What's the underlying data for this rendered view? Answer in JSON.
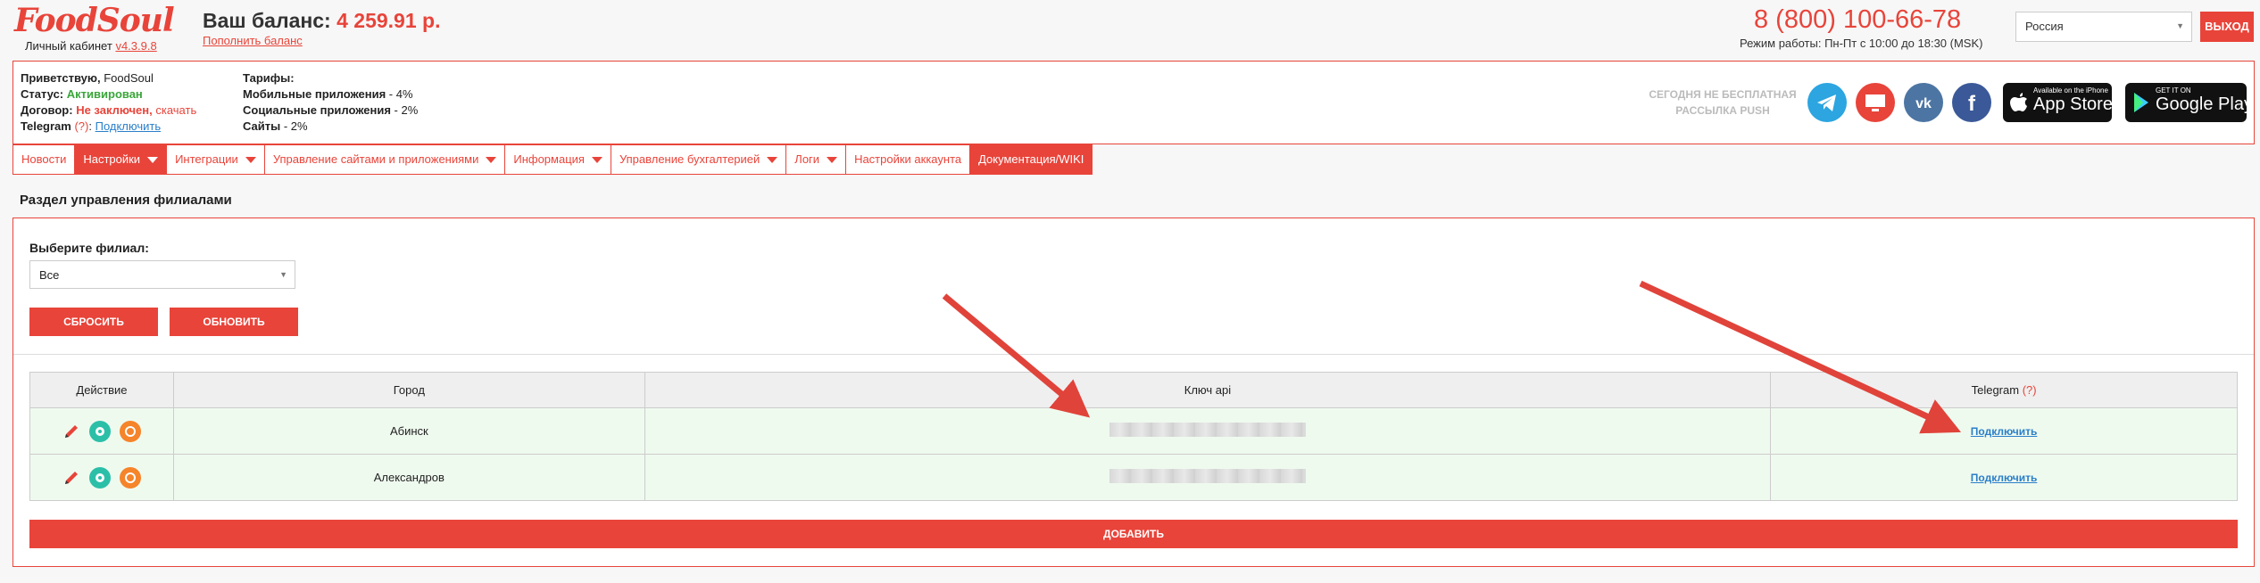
{
  "header": {
    "logo": "FoodSoul",
    "cabinet_label": "Личный кабинет",
    "version": "v4.3.9.8",
    "balance_label": "Ваш баланс:",
    "balance_value": "4 259.91 р.",
    "topup": "Пополнить баланс",
    "phone": "8 (800) 100-66-78",
    "hours": "Режим работы: Пн-Пт с 10:00 до 18:30 (MSK)",
    "country": "Россия",
    "logout": "ВЫХОД"
  },
  "info": {
    "greeting_label": "Приветствую,",
    "greeting_name": "FoodSoul",
    "status_label": "Статус:",
    "status_value": "Активирован",
    "contract_label": "Договор:",
    "contract_value": "Не заключен,",
    "contract_link": "скачать",
    "telegram_label": "Telegram",
    "telegram_q": "(?)",
    "telegram_link": "Подключить",
    "tariffs_title": "Тарифы:",
    "tariff_mobile_label": "Мобильные приложения",
    "tariff_mobile_value": " - 4%",
    "tariff_social_label": "Социальные приложения",
    "tariff_social_value": " - 2%",
    "tariff_sites_label": "Сайты",
    "tariff_sites_value": " - 2%",
    "push_note": "СЕГОДНЯ НЕ БЕСПЛАТНАЯ РАССЫЛКА PUSH",
    "appstore_small": "Available on the iPhone",
    "appstore_big": "App Store",
    "googleplay_small": "GET IT ON",
    "googleplay_big": "Google Play"
  },
  "nav": [
    {
      "label": "Новости",
      "dropdown": false,
      "active": false
    },
    {
      "label": "Настройки",
      "dropdown": true,
      "active": true
    },
    {
      "label": "Интеграции",
      "dropdown": true,
      "active": false
    },
    {
      "label": "Управление сайтами и приложениями",
      "dropdown": true,
      "active": false
    },
    {
      "label": "Информация",
      "dropdown": true,
      "active": false
    },
    {
      "label": "Управление бухгалтерией",
      "dropdown": true,
      "active": false
    },
    {
      "label": "Логи",
      "dropdown": true,
      "active": false
    },
    {
      "label": "Настройки аккаунта",
      "dropdown": false,
      "active": false
    },
    {
      "label": "Документация/WIKI",
      "dropdown": false,
      "active": true
    }
  ],
  "section_title": "Раздел управления филиалами",
  "filter": {
    "label": "Выберите филиал:",
    "value": "Все",
    "reset": "СБРОСИТЬ",
    "update": "ОБНОВИТЬ"
  },
  "table": {
    "headers": [
      "Действие",
      "Город",
      "Ключ api",
      "Telegram"
    ],
    "telegram_q": "(?)",
    "rows": [
      {
        "city": "Абинск",
        "telegram": "Подключить"
      },
      {
        "city": "Александров",
        "telegram": "Подключить"
      }
    ]
  },
  "add_button": "ДОБАВИТЬ",
  "colors": {
    "accent": "#e8443a",
    "row_bg": "#effaef",
    "link": "#2a7fc9"
  }
}
